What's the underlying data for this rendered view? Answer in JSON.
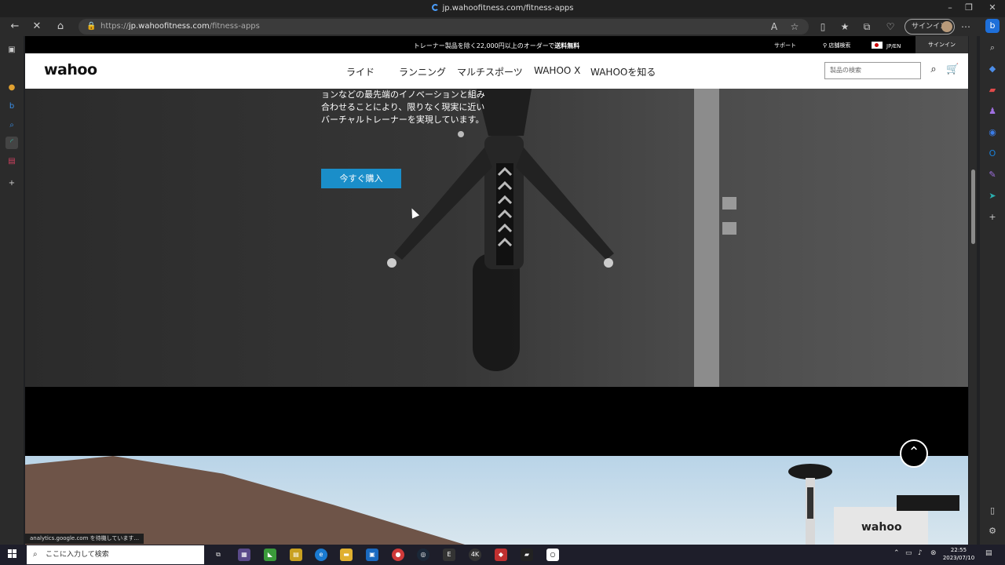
{
  "window": {
    "title": "jp.wahoofitness.com/fitness-apps",
    "controls": [
      "–",
      "❐",
      "✕"
    ]
  },
  "browser": {
    "url_prefix": "https://",
    "url_host": "jp.wahoofitness.com",
    "url_path": "/fitness-apps",
    "signin_label": "サインイン",
    "status_text": "analytics.google.com を待機しています..."
  },
  "site": {
    "promo": "トレーナー製品を除く22,000円以上のオーダーで",
    "promo_bold": "送料無料",
    "support": "サポート",
    "store_search": "店舗検索",
    "lang": "JP/EN",
    "signin": "サインイン",
    "logo": "wahoo",
    "nav": [
      "ライド",
      "ランニング",
      "マルチスポーツ",
      "WAHOO X",
      "WAHOOを知る"
    ],
    "search_placeholder": "製品の検索"
  },
  "hero": {
    "text": "ョンなどの最先端のイノベーションと組み合わせることにより、限りなく現実に近いバーチャルトレーナーを実現しています。",
    "buy_button": "今すぐ購入"
  },
  "taskbar": {
    "search_placeholder": "ここに入力して検索",
    "time": "22:55",
    "date": "2023/07/10"
  },
  "colors": {
    "accent": "#1a8ec9",
    "edge_blue": "#1e6fd9"
  }
}
